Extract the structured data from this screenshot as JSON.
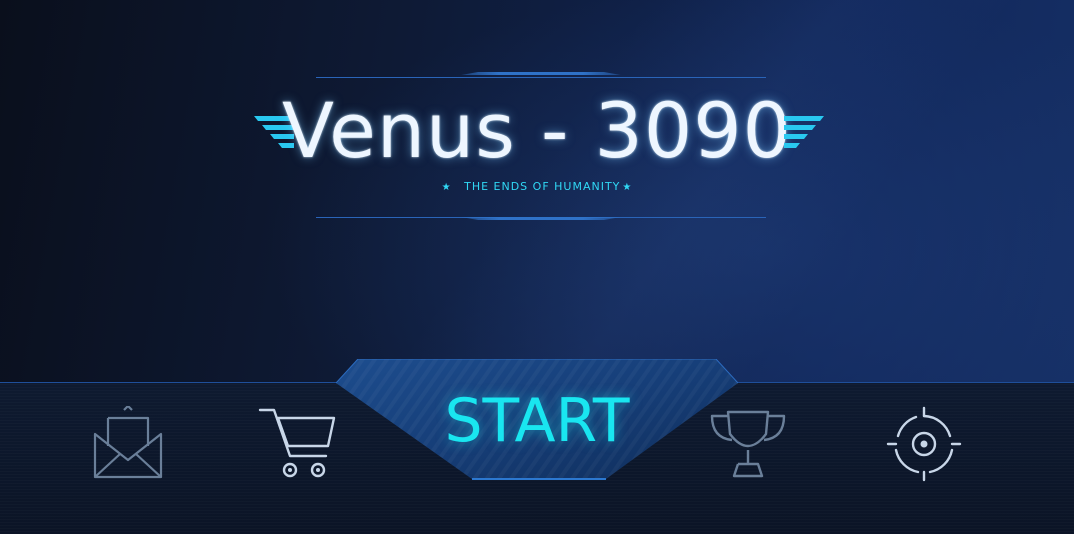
{
  "title": {
    "main": "Venus - 3090",
    "subtitle": "THE ENDS OF HUMANITY",
    "subtitle_star": "★"
  },
  "menu": {
    "start_label": "START",
    "icons": [
      "mail-icon",
      "cart-icon",
      "trophy-icon",
      "settings-crosshair-icon"
    ]
  },
  "colors": {
    "accent_cyan": "#19e6f0",
    "icon_muted": "#6a7f99",
    "icon_light": "#c8d6e8",
    "rule_blue": "#2a64b8"
  }
}
